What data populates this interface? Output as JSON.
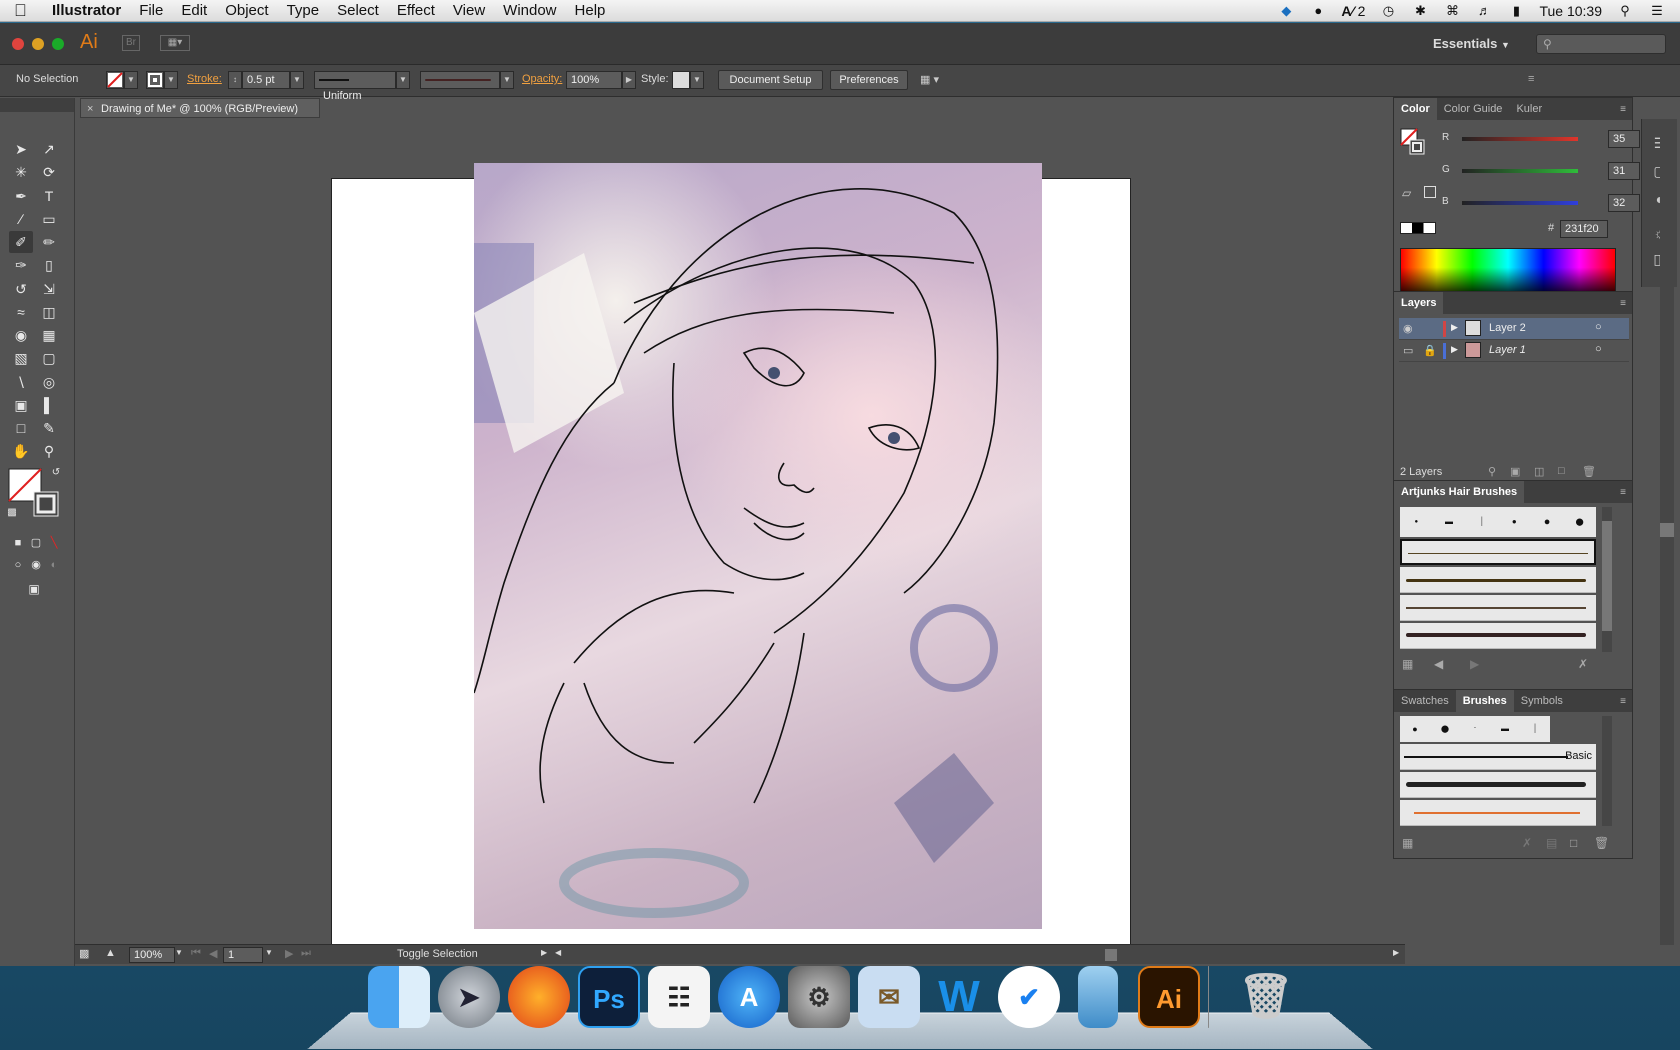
{
  "menubar": {
    "app_name": "Illustrator",
    "items": [
      "File",
      "Edit",
      "Object",
      "Type",
      "Select",
      "Effect",
      "View",
      "Window",
      "Help"
    ],
    "adobe_count": "2",
    "clock": "Tue 10:39"
  },
  "titlebar": {
    "app_logo": "Ai",
    "bridge_logo": "Br",
    "workspace": "Essentials"
  },
  "controlbar": {
    "selection": "No Selection",
    "stroke_label": "Stroke:",
    "stroke_value": "0.5 pt",
    "profile": "Uniform",
    "opacity_label": "Opacity:",
    "opacity_value": "100%",
    "style_label": "Style:",
    "document_setup": "Document Setup",
    "preferences": "Preferences"
  },
  "document": {
    "tab_title": "Drawing of Me* @ 100% (RGB/Preview)"
  },
  "statusbar": {
    "zoom": "100%",
    "page": "1",
    "status_text": "Toggle Selection"
  },
  "color_panel": {
    "tabs": [
      "Color",
      "Color Guide",
      "Kuler"
    ],
    "r_label": "R",
    "r_value": "35",
    "g_label": "G",
    "g_value": "31",
    "b_label": "B",
    "b_value": "32",
    "hash": "#",
    "hex_value": "231f20",
    "colors": {
      "r_track": "#e0352b",
      "g_track": "#2fbd3a",
      "b_track": "#2f3fdc"
    }
  },
  "layers_panel": {
    "title": "Layers",
    "layers": [
      {
        "name": "Layer 2",
        "color": "#d04545"
      },
      {
        "name": "Layer 1",
        "color": "#4a6fd6"
      }
    ],
    "count": "2 Layers"
  },
  "hair_brushes_panel": {
    "title": "Artjunks Hair Brushes"
  },
  "brushes_panel": {
    "tabs": [
      "Swatches",
      "Brushes",
      "Symbols"
    ],
    "basic_label": "Basic"
  },
  "icons": {
    "wifi": "wifi-icon",
    "volume": "volume-icon",
    "search": "search-icon",
    "list": "list-icon"
  }
}
